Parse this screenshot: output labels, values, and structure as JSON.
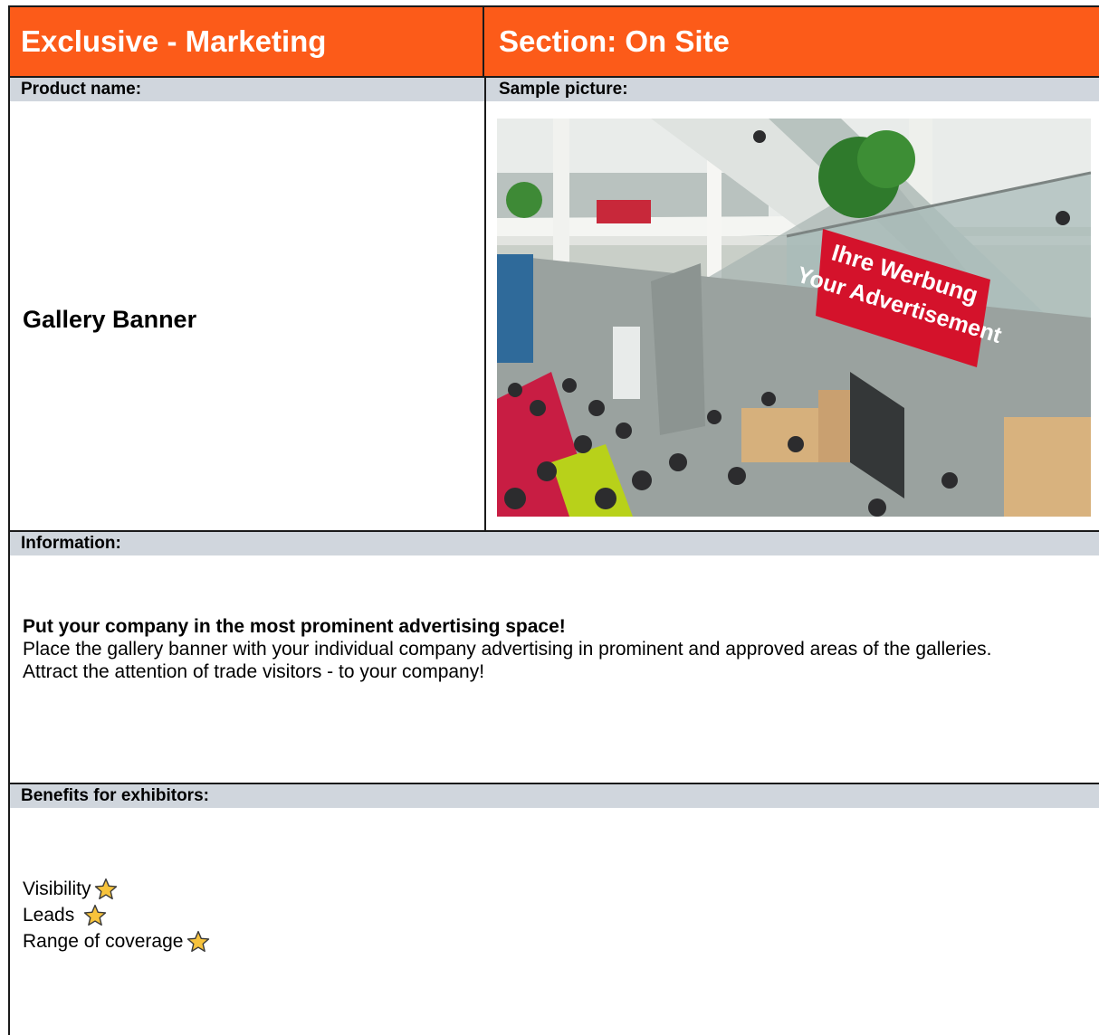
{
  "header": {
    "left_title": "Exclusive - Marketing",
    "right_title": "Section: On Site"
  },
  "product": {
    "label": "Product name:",
    "name": "Gallery Banner"
  },
  "sample": {
    "label": "Sample picture:",
    "banner_line1": "Ihre Werbung",
    "banner_line2": "Your Advertisement"
  },
  "information": {
    "label": "Information:",
    "headline": "Put your company in the most prominent advertising space!",
    "line1": "Place the gallery banner with your individual company advertising in prominent and approved areas of the galleries.",
    "line2": "Attract the attention of trade visitors - to your company!"
  },
  "benefits": {
    "label": "Benefits for exhibitors:",
    "items": [
      {
        "label": "Visibility",
        "icon": "star-icon"
      },
      {
        "label": "Leads",
        "icon": "star-icon"
      },
      {
        "label": "Range of coverage",
        "icon": "star-icon"
      }
    ]
  },
  "colors": {
    "header_orange": "#fc5b19",
    "subheader_gray": "#d0d6dd",
    "star_fill": "#f7c33c",
    "banner_red": "#d4122b"
  }
}
